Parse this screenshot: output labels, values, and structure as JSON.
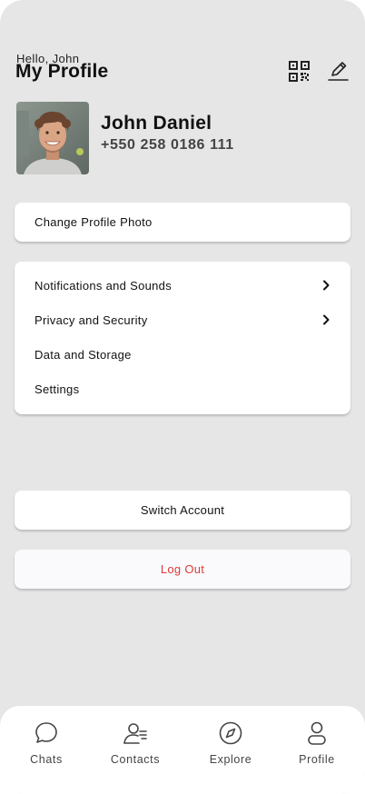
{
  "header": {
    "greeting": "Hello, John",
    "title": "My Profile"
  },
  "profile": {
    "name": "John Daniel",
    "phone": "+550 258 0186 111"
  },
  "actions": {
    "change_photo": "Change Profile Photo",
    "switch_account": "Switch Account",
    "log_out": "Log Out"
  },
  "menu": {
    "items": [
      {
        "label": "Notifications and Sounds",
        "icon": "chevron-right-icon"
      },
      {
        "label": "Privacy and Security",
        "icon": "chevron-right-icon"
      },
      {
        "label": "Data and Storage"
      },
      {
        "label": "Settings"
      }
    ]
  },
  "tabs": [
    {
      "label": "Chats",
      "icon": "chat-bubble-icon"
    },
    {
      "label": "Contacts",
      "icon": "contacts-icon"
    },
    {
      "label": "Explore",
      "icon": "compass-icon"
    },
    {
      "label": "Profile",
      "icon": "person-icon"
    }
  ],
  "colors": {
    "background": "#e6e6e6",
    "card": "#ffffff",
    "logout_text": "#e03a3a"
  }
}
